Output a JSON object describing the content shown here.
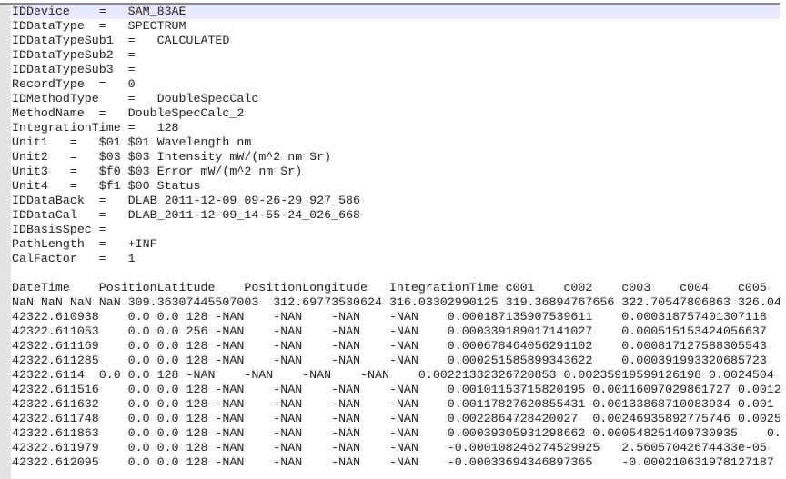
{
  "editor": {
    "current_line_color": "#e8e8ff",
    "current_line": 1,
    "lines": [
      "IDDevice\t=\tSAM_83AE",
      "IDDataType\t=\tSPECTRUM",
      "IDDataTypeSub1\t=\tCALCULATED",
      "IDDataTypeSub2\t=",
      "IDDataTypeSub3\t=",
      "RecordType\t=\t0",
      "IDMethodType\t=\tDoubleSpecCalc",
      "MethodName\t=\tDoubleSpecCalc_2",
      "IntegrationTime =\t128",
      "Unit1\t=\t$01 $01 Wavelength nm",
      "Unit2\t=\t$03 $03 Intensity mW/(m^2 nm Sr)",
      "Unit3\t=\t$f0 $03 Error mW/(m^2 nm Sr)",
      "Unit4\t=\t$f1 $00 Status",
      "IDDataBack\t=\tDLAB_2011-12-09_09-26-29_927_586",
      "IDDataCal\t=\tDLAB_2011-12-09_14-55-24_026_668",
      "IDBasisSpec =",
      "PathLength\t=\t+INF",
      "CalFactor\t=\t1",
      "",
      "DateTime\tPositionLatitude\tPositionLongitude\tIntegrationTime c001\tc002\tc003\tc004\tc005",
      "NaN NaN NaN NaN 309.36307445507003\t312.69773530624\t316.03302990125 319.36894767656 322.70547806863 326.04",
      "42322.610938\t0.0 0.0 128 -NAN\t-NAN\t-NAN\t-NAN\t0.000187135907539611\t0.000318757401307118",
      "42322.611053\t0.0 0.0 256 -NAN\t-NAN\t-NAN\t-NAN\t0.000339189017141027\t0.000515153424056637",
      "42322.611169\t0.0 0.0 128 -NAN\t-NAN\t-NAN\t-NAN\t0.000678464056291102\t0.000817127588305543",
      "42322.611285\t0.0 0.0 128 -NAN\t-NAN\t-NAN\t-NAN\t0.000251585899343622\t0.000391993320685723",
      "42322.6114\t0.0 0.0 128 -NAN\t-NAN\t-NAN\t-NAN\t0.00221332326720853\t0.00235919599126198\t0.0024504",
      "42322.611516\t0.0 0.0 128 -NAN\t-NAN\t-NAN\t-NAN\t0.00101153715820195\t0.00116097029861727\t0.0012",
      "42322.611632\t0.0 0.0 128 -NAN\t-NAN\t-NAN\t-NAN\t0.00117827620855431\t0.00133868710083934\t0.001",
      "42322.611748\t0.0 0.0 128 -NAN\t-NAN\t-NAN\t-NAN\t0.0022864728420027\t0.00246935892775746\t0.0025",
      "42322.611863\t0.0 0.0 128 -NAN\t-NAN\t-NAN\t-NAN\t0.00039305931298662\t0.000548251409730935\t0.",
      "42322.611979\t0.0 0.0 128 -NAN\t-NAN\t-NAN\t-NAN\t-0.000108246274529925\t2.56057042674433e-05",
      "42322.612095\t0.0 0.0 128 -NAN\t-NAN\t-NAN\t-NAN\t-0.00033694346897365\t-0.000210631978127187"
    ]
  }
}
